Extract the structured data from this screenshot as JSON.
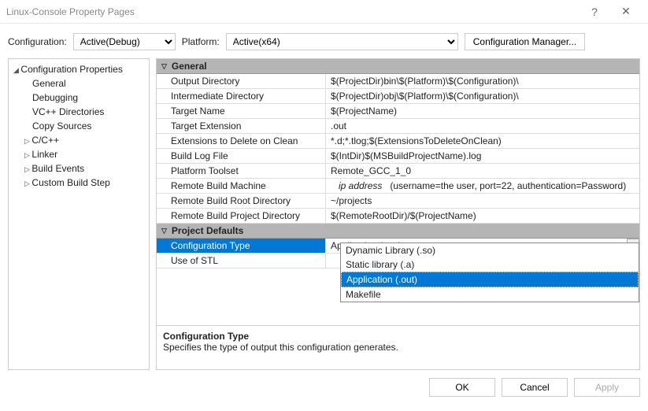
{
  "titlebar": {
    "title": "Linux-Console Property Pages",
    "help": "?",
    "close": "✕"
  },
  "config_row": {
    "config_label": "Configuration:",
    "config_value": "Active(Debug)",
    "platform_label": "Platform:",
    "platform_value": "Active(x64)",
    "manager_btn": "Configuration Manager..."
  },
  "tree": {
    "root": "Configuration Properties",
    "items": [
      "General",
      "Debugging",
      "VC++ Directories",
      "Copy Sources",
      "C/C++",
      "Linker",
      "Build Events",
      "Custom Build Step"
    ]
  },
  "sections": {
    "general": {
      "header": "General",
      "rows": [
        {
          "label": "Output Directory",
          "value": "$(ProjectDir)bin\\$(Platform)\\$(Configuration)\\"
        },
        {
          "label": "Intermediate Directory",
          "value": "$(ProjectDir)obj\\$(Platform)\\$(Configuration)\\"
        },
        {
          "label": "Target Name",
          "value": "$(ProjectName)"
        },
        {
          "label": "Target Extension",
          "value": ".out"
        },
        {
          "label": "Extensions to Delete on Clean",
          "value": "*.d;*.tlog;$(ExtensionsToDeleteOnClean)"
        },
        {
          "label": "Build Log File",
          "value": "$(IntDir)$(MSBuildProjectName).log"
        },
        {
          "label": "Platform Toolset",
          "value": "Remote_GCC_1_0"
        },
        {
          "label": "Remote Build Machine",
          "ip": "ip address",
          "detail": "(username=the user, port=22, authentication=Password)"
        },
        {
          "label": "Remote Build Root Directory",
          "value": "~/projects"
        },
        {
          "label": "Remote Build Project Directory",
          "value": "$(RemoteRootDir)/$(ProjectName)"
        }
      ]
    },
    "defaults": {
      "header": "Project Defaults",
      "rows": [
        {
          "label": "Configuration Type",
          "value": "Application (.out)"
        },
        {
          "label": "Use of STL",
          "value": ""
        }
      ]
    }
  },
  "dropdown": {
    "items": [
      "Dynamic Library (.so)",
      "Static library (.a)",
      "Application (.out)",
      "Makefile"
    ],
    "selected_index": 2
  },
  "description": {
    "title": "Configuration Type",
    "text": "Specifies the type of output this configuration generates."
  },
  "buttons": {
    "ok": "OK",
    "cancel": "Cancel",
    "apply": "Apply"
  }
}
